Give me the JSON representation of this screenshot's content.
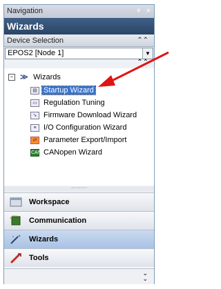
{
  "navigation": {
    "title": "Navigation",
    "pin": "ᵠ",
    "close": "×"
  },
  "wizards": {
    "title": "Wizards"
  },
  "device_selection": {
    "label": "Device Selection",
    "collapse": "⌃",
    "value": "EPOS2 [Node 1]"
  },
  "tree": {
    "root_toggle": "−",
    "root_label": "Wizards",
    "items": [
      {
        "label": "Startup Wizard",
        "icon": "startup-wizard-icon",
        "selected": true
      },
      {
        "label": "Regulation Tuning",
        "icon": "regulation-tuning-icon"
      },
      {
        "label": "Firmware Download Wizard",
        "icon": "firmware-download-icon"
      },
      {
        "label": "I/O Configuration Wizard",
        "icon": "io-configuration-icon"
      },
      {
        "label": "Parameter Export/Import",
        "icon": "parameter-export-import-icon"
      },
      {
        "label": "CANopen Wizard",
        "icon": "canopen-wizard-icon"
      }
    ]
  },
  "splitter": "··········",
  "buttons": [
    {
      "label": "Workspace",
      "icon": "workspace-icon"
    },
    {
      "label": "Communication",
      "icon": "communication-icon"
    },
    {
      "label": "Wizards",
      "icon": "wizards-icon",
      "active": true
    },
    {
      "label": "Tools",
      "icon": "tools-icon"
    }
  ],
  "more": "»",
  "colors": {
    "header_blue": "#2a4566",
    "selection": "#3874d1",
    "arrow_red": "#e01414"
  }
}
